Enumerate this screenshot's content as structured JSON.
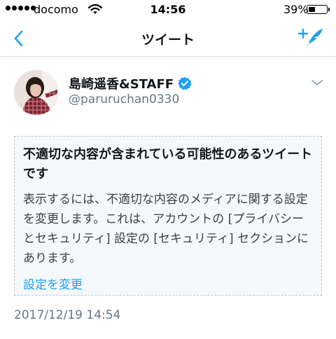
{
  "status_bar": {
    "carrier": "docomo",
    "time": "14:56",
    "battery_percent": "39%",
    "battery_level": 0.39,
    "signal_bars": 5
  },
  "nav": {
    "title": "ツイート",
    "back_icon": "chevron-left-icon",
    "compose_icon": "compose-tweet-icon",
    "accent_color": "#1da1f2"
  },
  "tweet": {
    "author_name": "島崎遥香&STAFF",
    "handle": "@paruruchan0330",
    "verified": true,
    "timestamp": "2017/12/19 14:54"
  },
  "notice": {
    "title": "不適切な内容が含まれている可能性のあるツイートです",
    "body": "表示するには、不適切な内容のメディアに関する設定を変更します。これは、アカウントの [プライバシーとセキュリティ] 設定の [セキュリティ] セクションにあります。",
    "link_label": "設定を変更"
  }
}
